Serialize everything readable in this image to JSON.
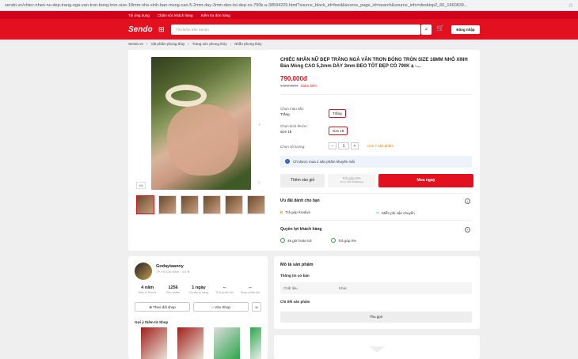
{
  "browser": {
    "url": "sendo.vn/chiec-nhan-nu-dep-trang-nga-van-tron-bong-tron-size-18mm-nho-xinh-ban-mong-cao-5-2mm-day-3mm-deo-toi-dep-co-790k-a-38594229.html?source_block_id=feed&source_page_id=search&source_info=desktop2_60_1660839..."
  },
  "topbar": {
    "links": [
      "Tải ứng dụng",
      "Chăm sóc khách hàng",
      "Kiểm tra đơn hàng"
    ]
  },
  "header": {
    "logo": "Sendo",
    "search_placeholder": "Tìm kiếm trên Sendo",
    "login": "Đăng nhập"
  },
  "breadcrumb": [
    "Sendo.vn",
    "Vật phẩm phong thủy",
    "Trang sức phong thủy",
    "Nhẫn phong thủy"
  ],
  "product": {
    "title": "CHIẾC NHẪN NỮ ĐẸP TRẮNG NGÀ VÂN TRƠN BÓNG TRÒN SIZE 18MM NHỎ XINH Bản Mỏng CAO 5,2mm DÀY 3mm ĐEO TỐT ĐẸP CÓ 790K ạ -...",
    "price": "790.000đ",
    "old_price": "1.580.000đ",
    "discount": "Giảm 50%",
    "image_counter": "1/6",
    "color_label": "Chọn màu sắc:",
    "color_value": "Trắng",
    "color_option": "Trắng",
    "size_label": "Chọn kích thước:",
    "size_value": "size 18",
    "size_option": "size 18",
    "qty_label": "Chọn số lượng:",
    "qty_minus": "−",
    "qty": "1",
    "qty_plus": "+",
    "stock_left": "Còn 7 sản phẩm",
    "info_notice": "Chỉ được mua 2 sản phẩm khuyến mãi",
    "add_to_cart": "Thêm vào giỏ",
    "installment": "Trả góp 0%",
    "installment_sub": "Chỉ từ 395.000đ/tháng",
    "buy_now": "Mua ngay",
    "perks_title": "Ưu đãi dành cho bạn",
    "perk1": "Trả góp Kredivo",
    "perk2": "Miễn phí vận chuyển",
    "rights_title": "Quyền lợi khách hàng",
    "right1": "48 giờ hoàn trả",
    "right2": "Trả góp 0%"
  },
  "shop": {
    "name": "Godaytaanny",
    "sub": "TP. Hồ Chí Minh · 4.6 ★",
    "stats": [
      {
        "value": "4 năm",
        "label": "Bán ở Sendo"
      },
      {
        "value": "1256",
        "label": "Sản phẩm"
      },
      {
        "value": "1 ngày",
        "label": "Chuẩn bị hàng"
      },
      {
        "value": "--",
        "label": "Tỉ lệ phản hồi"
      },
      {
        "value": "--",
        "label": "Shop phản hồi"
      }
    ],
    "follow": "Theo dõi shop",
    "visit": "Vào Shop",
    "suggest_title": "Gợi ý thêm từ Shop"
  },
  "details": {
    "title": "Mô tả sản phẩm",
    "basic_info": "Thông tin cơ bản",
    "material_label": "Chất liệu",
    "material_value": "Khác",
    "detail_label": "Chi tiết sản phẩm",
    "more": "Thu gọn"
  }
}
